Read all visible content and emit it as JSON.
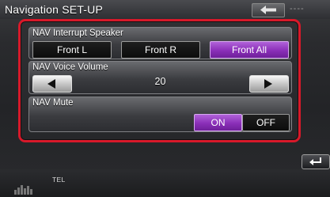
{
  "window": {
    "title": "Navigation SET-UP",
    "title_dashes": "----"
  },
  "sections": {
    "interrupt": {
      "label": "NAV Interrupt Speaker",
      "options": [
        "Front L",
        "Front R",
        "Front All"
      ],
      "selected": "Front All"
    },
    "volume": {
      "label": "NAV Voice Volume",
      "value": "20"
    },
    "mute": {
      "label": "NAV Mute",
      "options": [
        "ON",
        "OFF"
      ],
      "selected": "ON"
    }
  },
  "bottombar": {
    "tel_label": "TEL"
  },
  "icons": {
    "back_top": "back-arrow-icon",
    "vol_down": "left-triangle-icon",
    "vol_up": "right-triangle-icon",
    "return": "return-arrow-icon",
    "equalizer": "equalizer-icon"
  },
  "colors": {
    "accent_selected": "#8a2fb8",
    "highlight_border": "#d8192a"
  }
}
